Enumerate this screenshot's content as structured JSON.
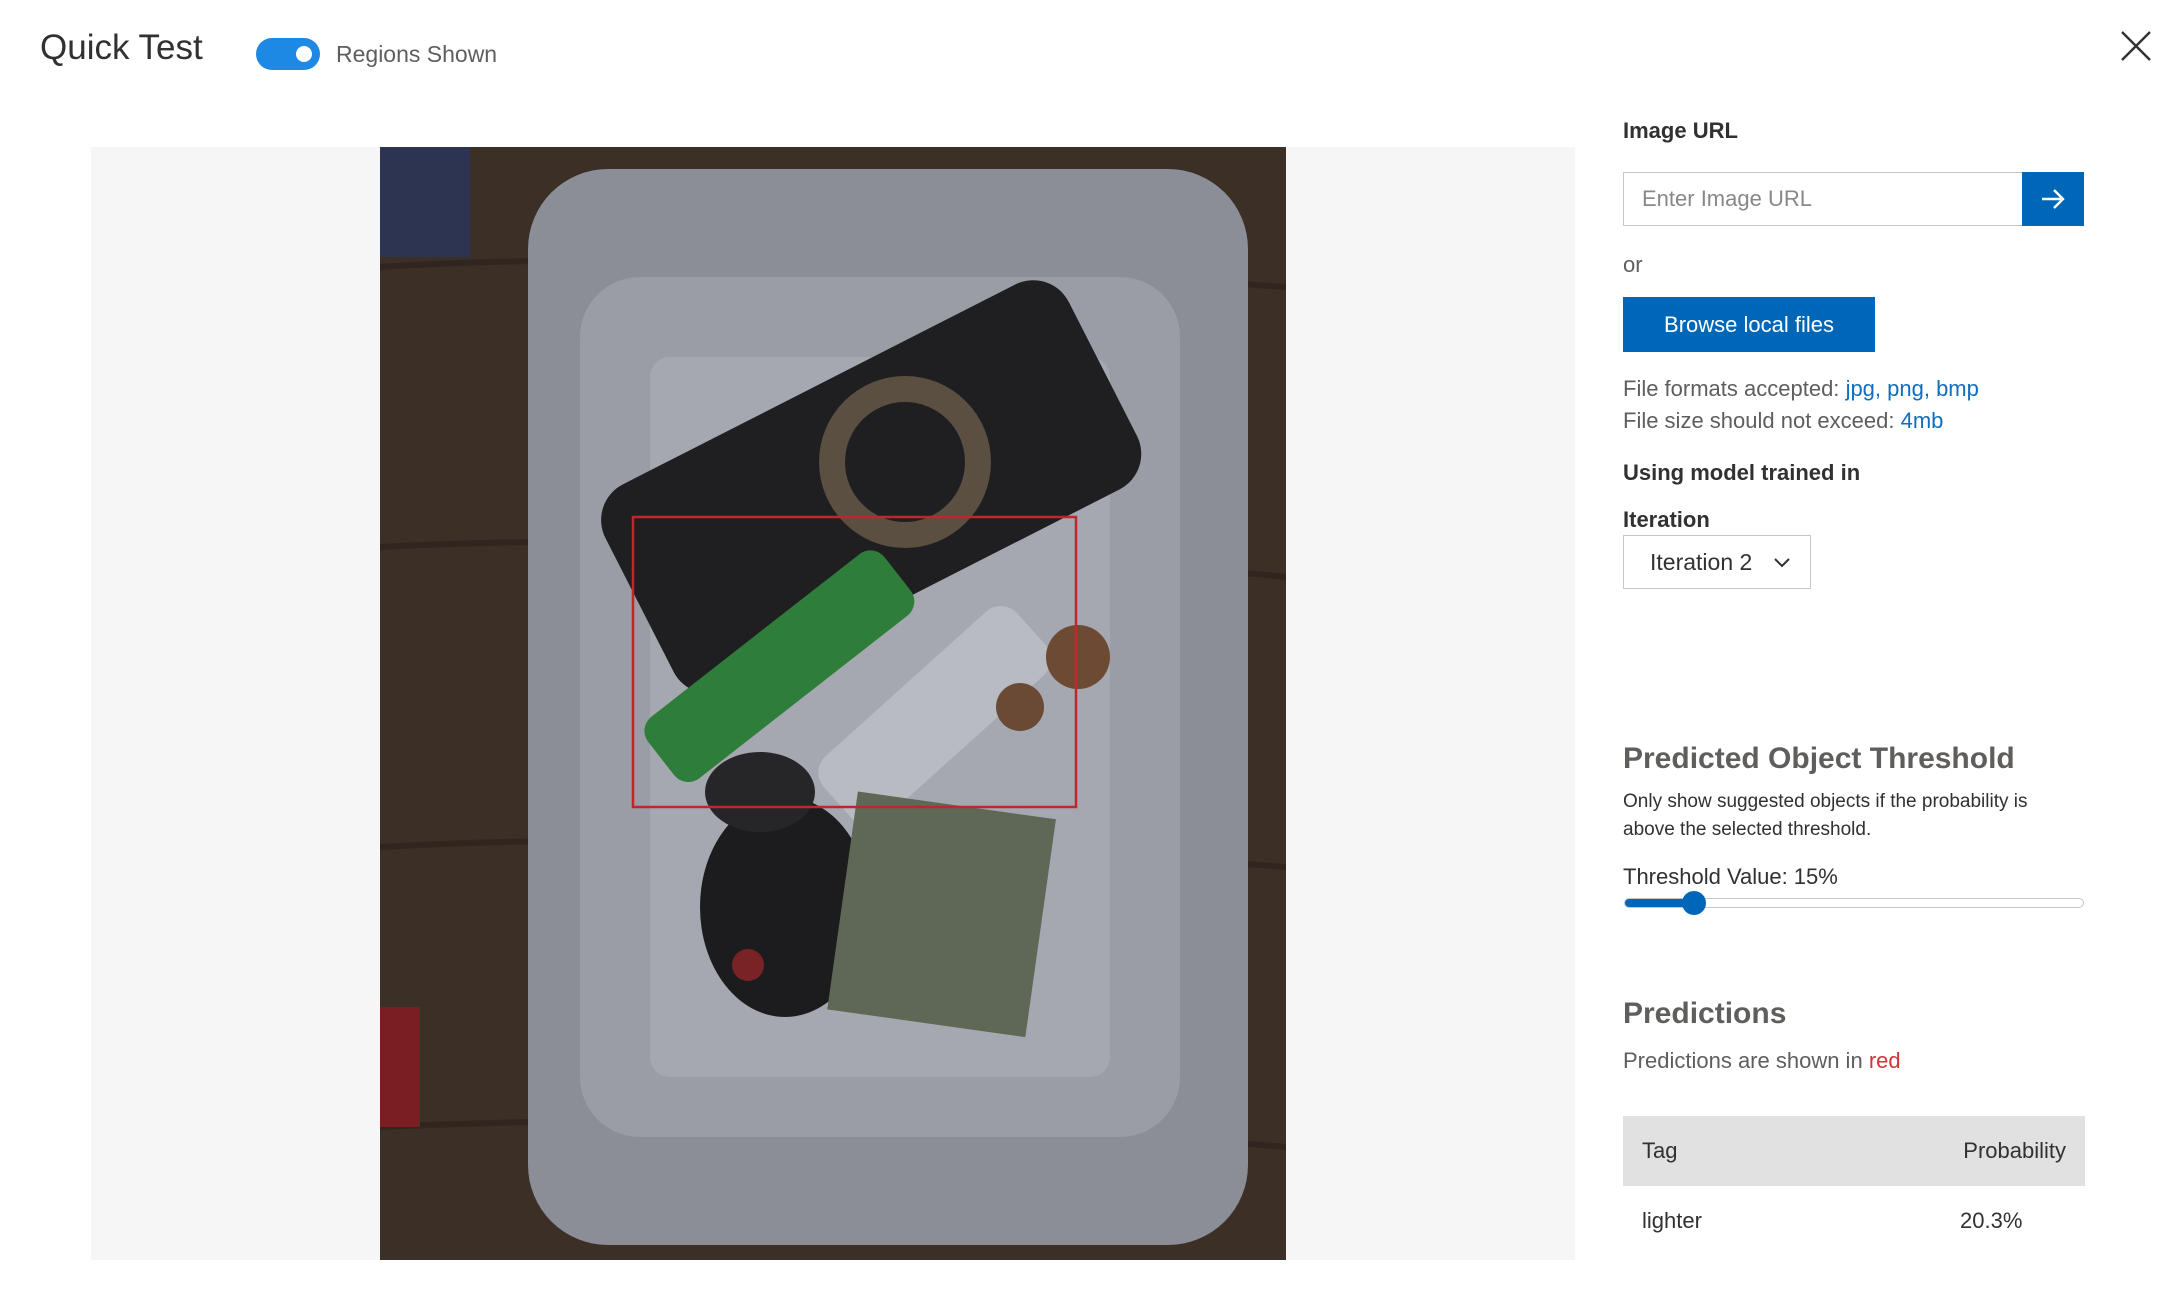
{
  "header": {
    "title": "Quick Test",
    "toggle_label": "Regions Shown",
    "toggle_on": true
  },
  "panel": {
    "image_url_label": "Image URL",
    "image_url_placeholder": "Enter Image URL",
    "or_text": "or",
    "browse_label": "Browse local files",
    "formats_prefix": "File formats accepted:",
    "formats_value": "jpg, png, bmp",
    "size_prefix": "File size should not exceed:",
    "size_value": "4mb",
    "model_heading": "Using model trained in",
    "iteration_label": "Iteration",
    "iteration_selected": "Iteration 2",
    "threshold_heading": "Predicted Object Threshold",
    "threshold_description": "Only show suggested objects if the probability is above the selected threshold.",
    "threshold_value_text": "Threshold Value: 15%",
    "threshold_value": 0.15,
    "predictions_heading": "Predictions",
    "predictions_prefix": "Predictions are shown in",
    "predictions_color_word": "red",
    "table": {
      "col_tag": "Tag",
      "col_probability": "Probability",
      "rows": [
        {
          "tag": "lighter",
          "probability": "20.3%"
        }
      ]
    }
  },
  "icons": {
    "close": "close-icon",
    "arrow": "arrow-right-icon",
    "chevron": "chevron-down-icon"
  },
  "colors": {
    "accent": "#0066b8",
    "toggle": "#1e88e5",
    "prediction_box": "#d13438"
  }
}
